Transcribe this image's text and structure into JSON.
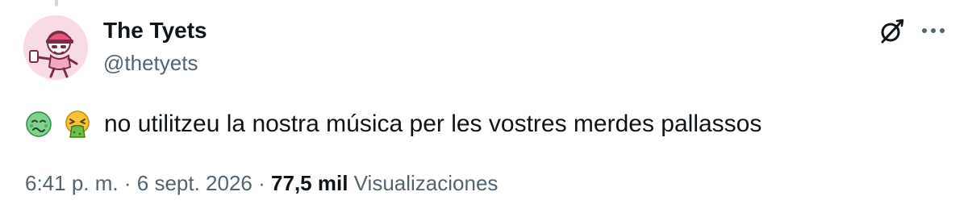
{
  "author": {
    "display_name": "The Tyets",
    "handle": "@thetyets"
  },
  "tweet": {
    "emojis": [
      "nauseated-face",
      "face-vomiting"
    ],
    "text": "no utilitzeu la nostra música per les vostres merdes pallassos"
  },
  "meta": {
    "time": "6:41 p. m.",
    "separator": "·",
    "date": "6 sept. 2026",
    "views_count": "77,5 mil",
    "views_label": "Visualizaciones"
  },
  "colors": {
    "avatar_bg": "#f9dbe6",
    "secondary_text": "#536471",
    "primary_text": "#0f1419"
  },
  "icons": {
    "grok": "grok-icon",
    "more": "more-options-icon"
  }
}
